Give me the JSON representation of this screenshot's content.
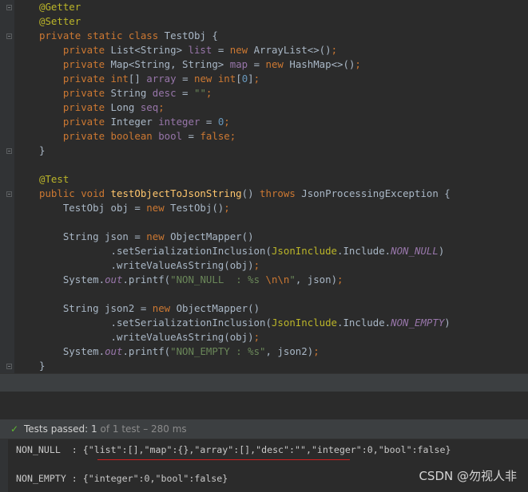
{
  "code_lines": [
    {
      "segments": [
        {
          "t": "@Getter",
          "c": "ann"
        }
      ]
    },
    {
      "segments": [
        {
          "t": "@Setter",
          "c": "ann"
        }
      ]
    },
    {
      "segments": [
        {
          "t": "private static class ",
          "c": "kw"
        },
        {
          "t": "TestObj {",
          "c": ""
        }
      ]
    },
    {
      "segments": [
        {
          "t": "    private ",
          "c": "kw"
        },
        {
          "t": "List<String> ",
          "c": ""
        },
        {
          "t": "list",
          "c": "fld"
        },
        {
          "t": " = ",
          "c": ""
        },
        {
          "t": "new ",
          "c": "kw"
        },
        {
          "t": "ArrayList<>()",
          "c": ""
        },
        {
          "t": ";",
          "c": "kw"
        }
      ]
    },
    {
      "segments": [
        {
          "t": "    private ",
          "c": "kw"
        },
        {
          "t": "Map<String, String> ",
          "c": ""
        },
        {
          "t": "map",
          "c": "fld"
        },
        {
          "t": " = ",
          "c": ""
        },
        {
          "t": "new ",
          "c": "kw"
        },
        {
          "t": "HashMap<>()",
          "c": ""
        },
        {
          "t": ";",
          "c": "kw"
        }
      ]
    },
    {
      "segments": [
        {
          "t": "    private int",
          "c": "kw"
        },
        {
          "t": "[] ",
          "c": ""
        },
        {
          "t": "array",
          "c": "fld"
        },
        {
          "t": " = ",
          "c": ""
        },
        {
          "t": "new int",
          "c": "kw"
        },
        {
          "t": "[",
          "c": ""
        },
        {
          "t": "0",
          "c": "num"
        },
        {
          "t": "]",
          "c": ""
        },
        {
          "t": ";",
          "c": "kw"
        }
      ]
    },
    {
      "segments": [
        {
          "t": "    private ",
          "c": "kw"
        },
        {
          "t": "String ",
          "c": ""
        },
        {
          "t": "desc",
          "c": "fld"
        },
        {
          "t": " = ",
          "c": ""
        },
        {
          "t": "\"\"",
          "c": "str"
        },
        {
          "t": ";",
          "c": "kw"
        }
      ]
    },
    {
      "segments": [
        {
          "t": "    private ",
          "c": "kw"
        },
        {
          "t": "Long ",
          "c": ""
        },
        {
          "t": "seq",
          "c": "fld"
        },
        {
          "t": ";",
          "c": "kw"
        }
      ]
    },
    {
      "segments": [
        {
          "t": "    private ",
          "c": "kw"
        },
        {
          "t": "Integer ",
          "c": ""
        },
        {
          "t": "integer",
          "c": "fld"
        },
        {
          "t": " = ",
          "c": ""
        },
        {
          "t": "0",
          "c": "num"
        },
        {
          "t": ";",
          "c": "kw"
        }
      ]
    },
    {
      "segments": [
        {
          "t": "    private boolean ",
          "c": "kw"
        },
        {
          "t": "bool",
          "c": "fld"
        },
        {
          "t": " = ",
          "c": ""
        },
        {
          "t": "false",
          "c": "kw"
        },
        {
          "t": ";",
          "c": "kw"
        }
      ]
    },
    {
      "segments": [
        {
          "t": "}",
          "c": ""
        }
      ]
    },
    {
      "segments": [
        {
          "t": "",
          "c": ""
        }
      ]
    },
    {
      "segments": [
        {
          "t": "@Test",
          "c": "ann"
        }
      ]
    },
    {
      "segments": [
        {
          "t": "public void ",
          "c": "kw"
        },
        {
          "t": "testObjectToJsonString",
          "c": "fn"
        },
        {
          "t": "() ",
          "c": ""
        },
        {
          "t": "throws ",
          "c": "kw"
        },
        {
          "t": "JsonProcessingException {",
          "c": ""
        }
      ]
    },
    {
      "segments": [
        {
          "t": "    TestObj obj = ",
          "c": ""
        },
        {
          "t": "new ",
          "c": "kw"
        },
        {
          "t": "TestObj()",
          "c": ""
        },
        {
          "t": ";",
          "c": "kw"
        }
      ]
    },
    {
      "segments": [
        {
          "t": "",
          "c": ""
        }
      ]
    },
    {
      "segments": [
        {
          "t": "    String json = ",
          "c": ""
        },
        {
          "t": "new ",
          "c": "kw"
        },
        {
          "t": "ObjectMapper()",
          "c": ""
        }
      ]
    },
    {
      "segments": [
        {
          "t": "            .setSerializationInclusion(",
          "c": ""
        },
        {
          "t": "JsonInclude",
          "c": "ann"
        },
        {
          "t": ".Include.",
          "c": ""
        },
        {
          "t": "NON_NULL",
          "c": "fld it"
        },
        {
          "t": ")",
          "c": ""
        }
      ]
    },
    {
      "segments": [
        {
          "t": "            .writeValueAsString(obj)",
          "c": ""
        },
        {
          "t": ";",
          "c": "kw"
        }
      ]
    },
    {
      "segments": [
        {
          "t": "    System.",
          "c": ""
        },
        {
          "t": "out",
          "c": "fld it"
        },
        {
          "t": ".printf(",
          "c": ""
        },
        {
          "t": "\"NON_NULL  : %s ",
          "c": "str"
        },
        {
          "t": "\\n\\n",
          "c": "esc"
        },
        {
          "t": "\"",
          "c": "str"
        },
        {
          "t": ", json)",
          "c": ""
        },
        {
          "t": ";",
          "c": "kw"
        }
      ]
    },
    {
      "segments": [
        {
          "t": "",
          "c": ""
        }
      ]
    },
    {
      "segments": [
        {
          "t": "    String json2 = ",
          "c": ""
        },
        {
          "t": "new ",
          "c": "kw"
        },
        {
          "t": "ObjectMapper()",
          "c": ""
        }
      ]
    },
    {
      "segments": [
        {
          "t": "            .setSerializationInclusion(",
          "c": ""
        },
        {
          "t": "JsonInclude",
          "c": "ann"
        },
        {
          "t": ".Include.",
          "c": ""
        },
        {
          "t": "NON_EMPTY",
          "c": "fld it"
        },
        {
          "t": ")",
          "c": ""
        }
      ]
    },
    {
      "segments": [
        {
          "t": "            .writeValueAsString(obj)",
          "c": ""
        },
        {
          "t": ";",
          "c": "kw"
        }
      ]
    },
    {
      "segments": [
        {
          "t": "    System.",
          "c": ""
        },
        {
          "t": "out",
          "c": "fld it"
        },
        {
          "t": ".printf(",
          "c": ""
        },
        {
          "t": "\"NON_EMPTY : %s\"",
          "c": "str"
        },
        {
          "t": ", json2)",
          "c": ""
        },
        {
          "t": ";",
          "c": "kw"
        }
      ]
    },
    {
      "segments": [
        {
          "t": "}",
          "c": ""
        }
      ]
    }
  ],
  "status": {
    "check": "✓",
    "passed_label": "Tests passed:",
    "passed_count": "1",
    "details": "of 1 test – 280 ms"
  },
  "output": {
    "line1": "NON_NULL  : {\"list\":[],\"map\":{},\"array\":[],\"desc\":\"\",\"integer\":0,\"bool\":false}",
    "line2": "NON_EMPTY : {\"integer\":0,\"bool\":false}"
  },
  "watermark": "CSDN @勿视人非"
}
